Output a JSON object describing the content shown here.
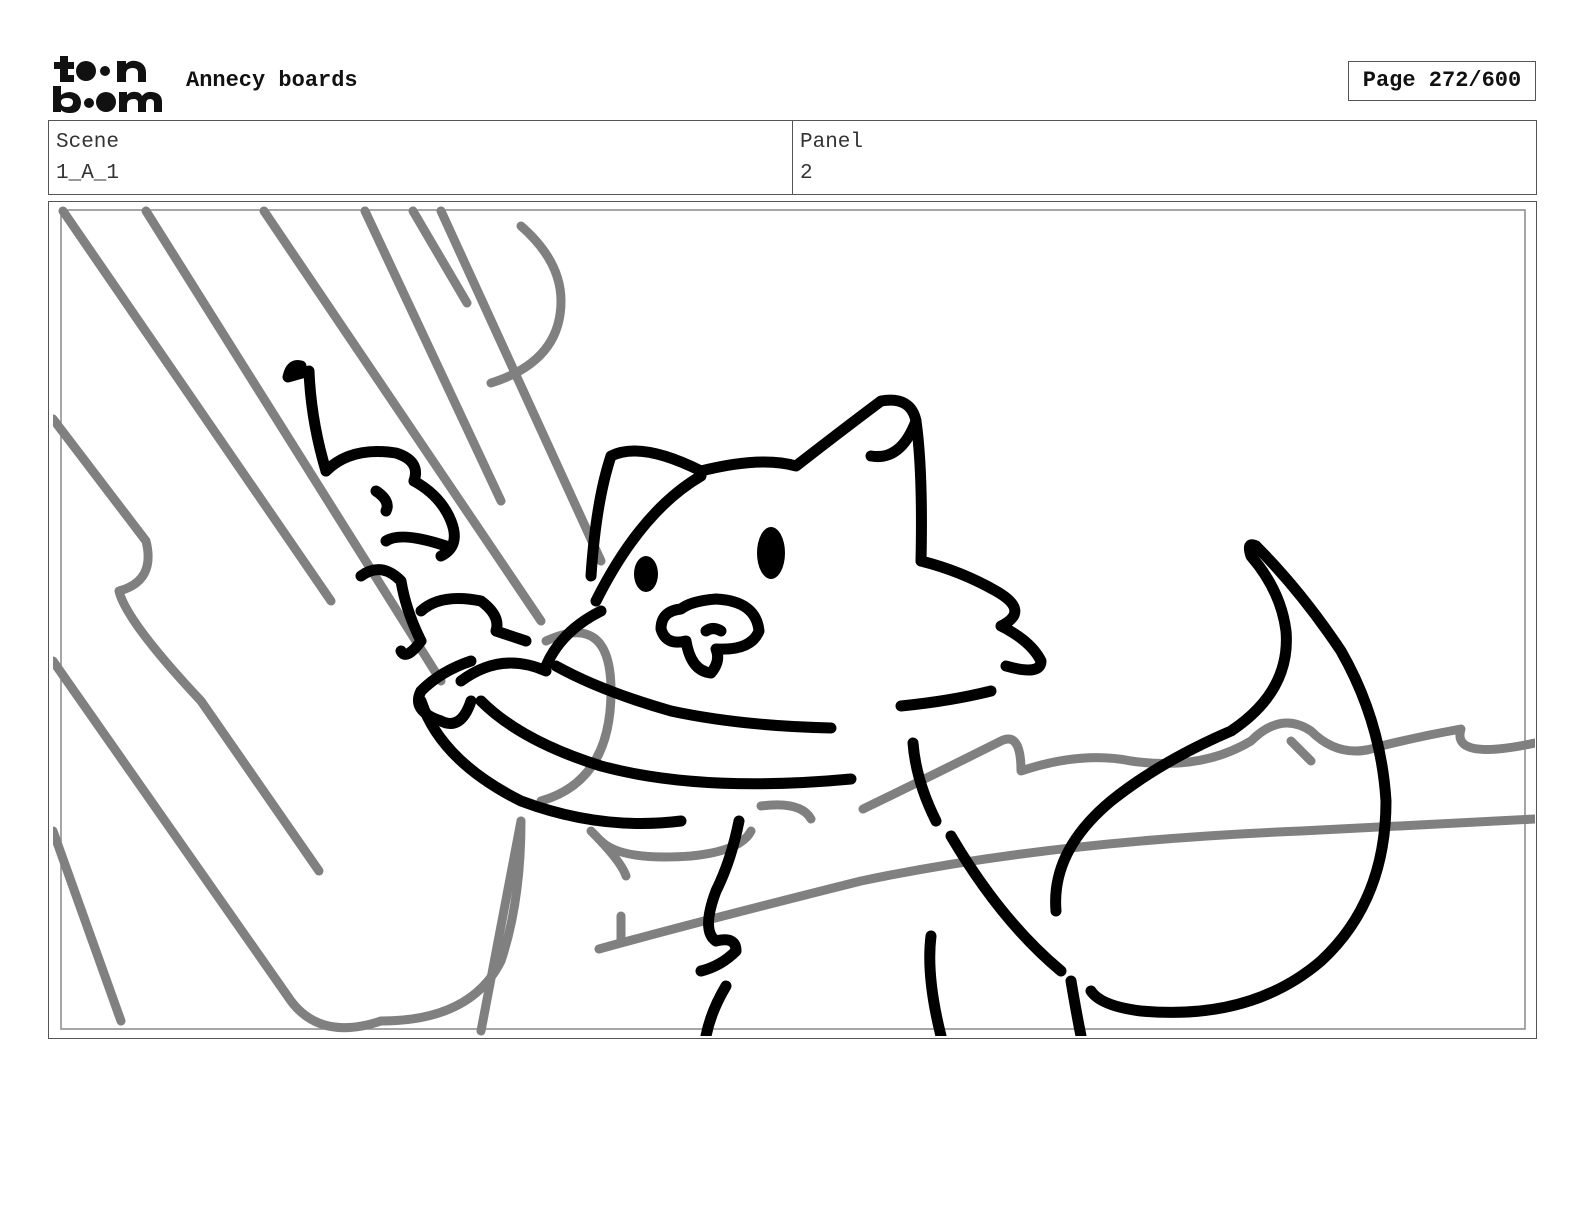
{
  "header": {
    "logo_text_top": "toon",
    "logo_text_bottom": "boom",
    "title": "Annecy boards",
    "page_label": "Page 272/600"
  },
  "info": {
    "scene_label": "Scene",
    "scene_value": "1_A_1",
    "panel_label": "Panel",
    "panel_value": "2"
  },
  "colors": {
    "ink": "#000000",
    "rough": "#808080",
    "border": "#555555"
  }
}
